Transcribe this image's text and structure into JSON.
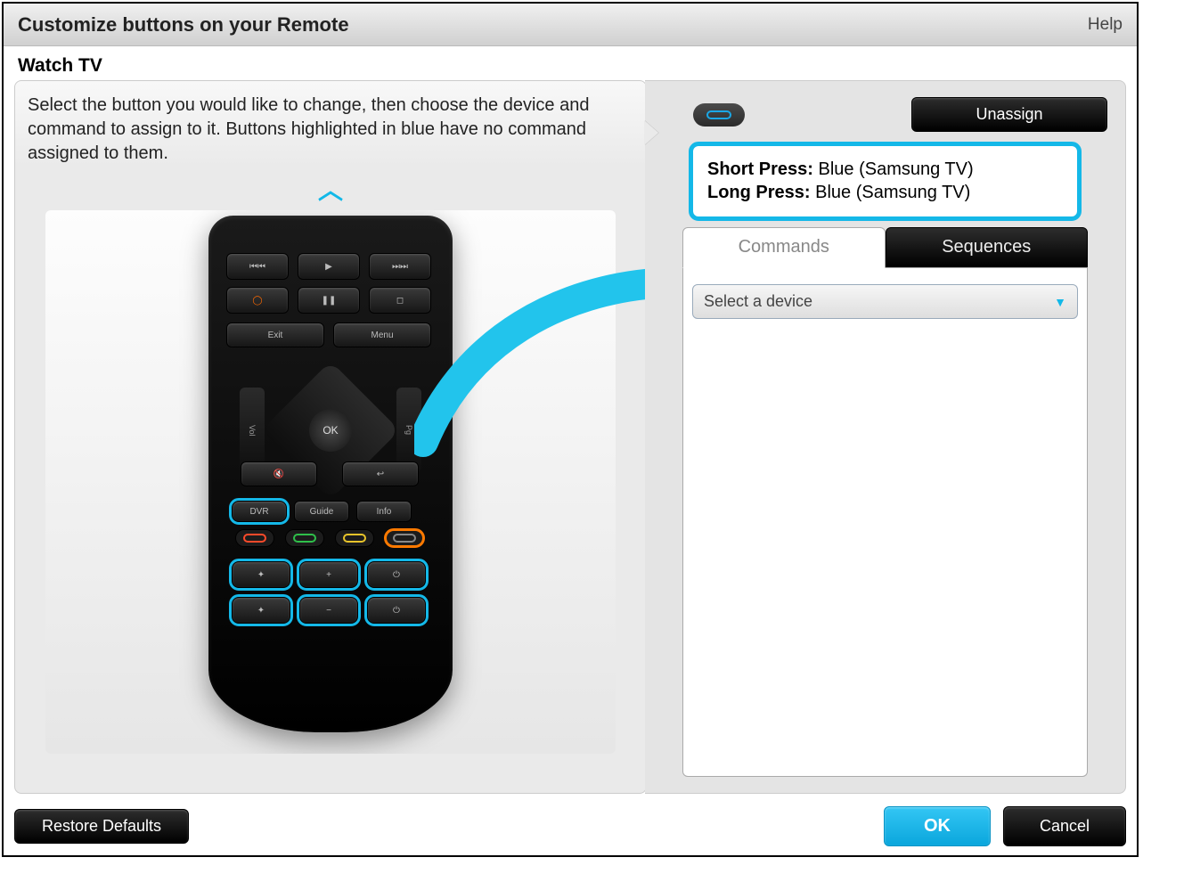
{
  "title": "Customize buttons on your Remote",
  "help": "Help",
  "activity": "Watch TV",
  "instructions": "Select the button you would like to change, then choose the device and command to assign to it. Buttons highlighted in blue have no command assigned to them.",
  "remote": {
    "skip_prev": "⏮⏮",
    "play": "▶",
    "skip_next": "⏭⏭",
    "record": "◯",
    "pause": "❚❚",
    "stop": "◻",
    "exit": "Exit",
    "menu": "Menu",
    "ok": "OK",
    "vol": "Vol",
    "pg": "Pg",
    "mute": "🔇",
    "back": "↩",
    "dvr": "DVR",
    "guide": "Guide",
    "info": "Info",
    "plus": "+",
    "minus": "−"
  },
  "assignments": {
    "short_label": "Short Press:",
    "short_value": "Blue (Samsung TV)",
    "long_label": "Long Press:",
    "long_value": "Blue (Samsung TV)"
  },
  "tabs": {
    "commands": "Commands",
    "sequences": "Sequences"
  },
  "device_select": {
    "placeholder": "Select a device"
  },
  "buttons": {
    "unassign": "Unassign",
    "restore": "Restore Defaults",
    "ok": "OK",
    "cancel": "Cancel"
  }
}
